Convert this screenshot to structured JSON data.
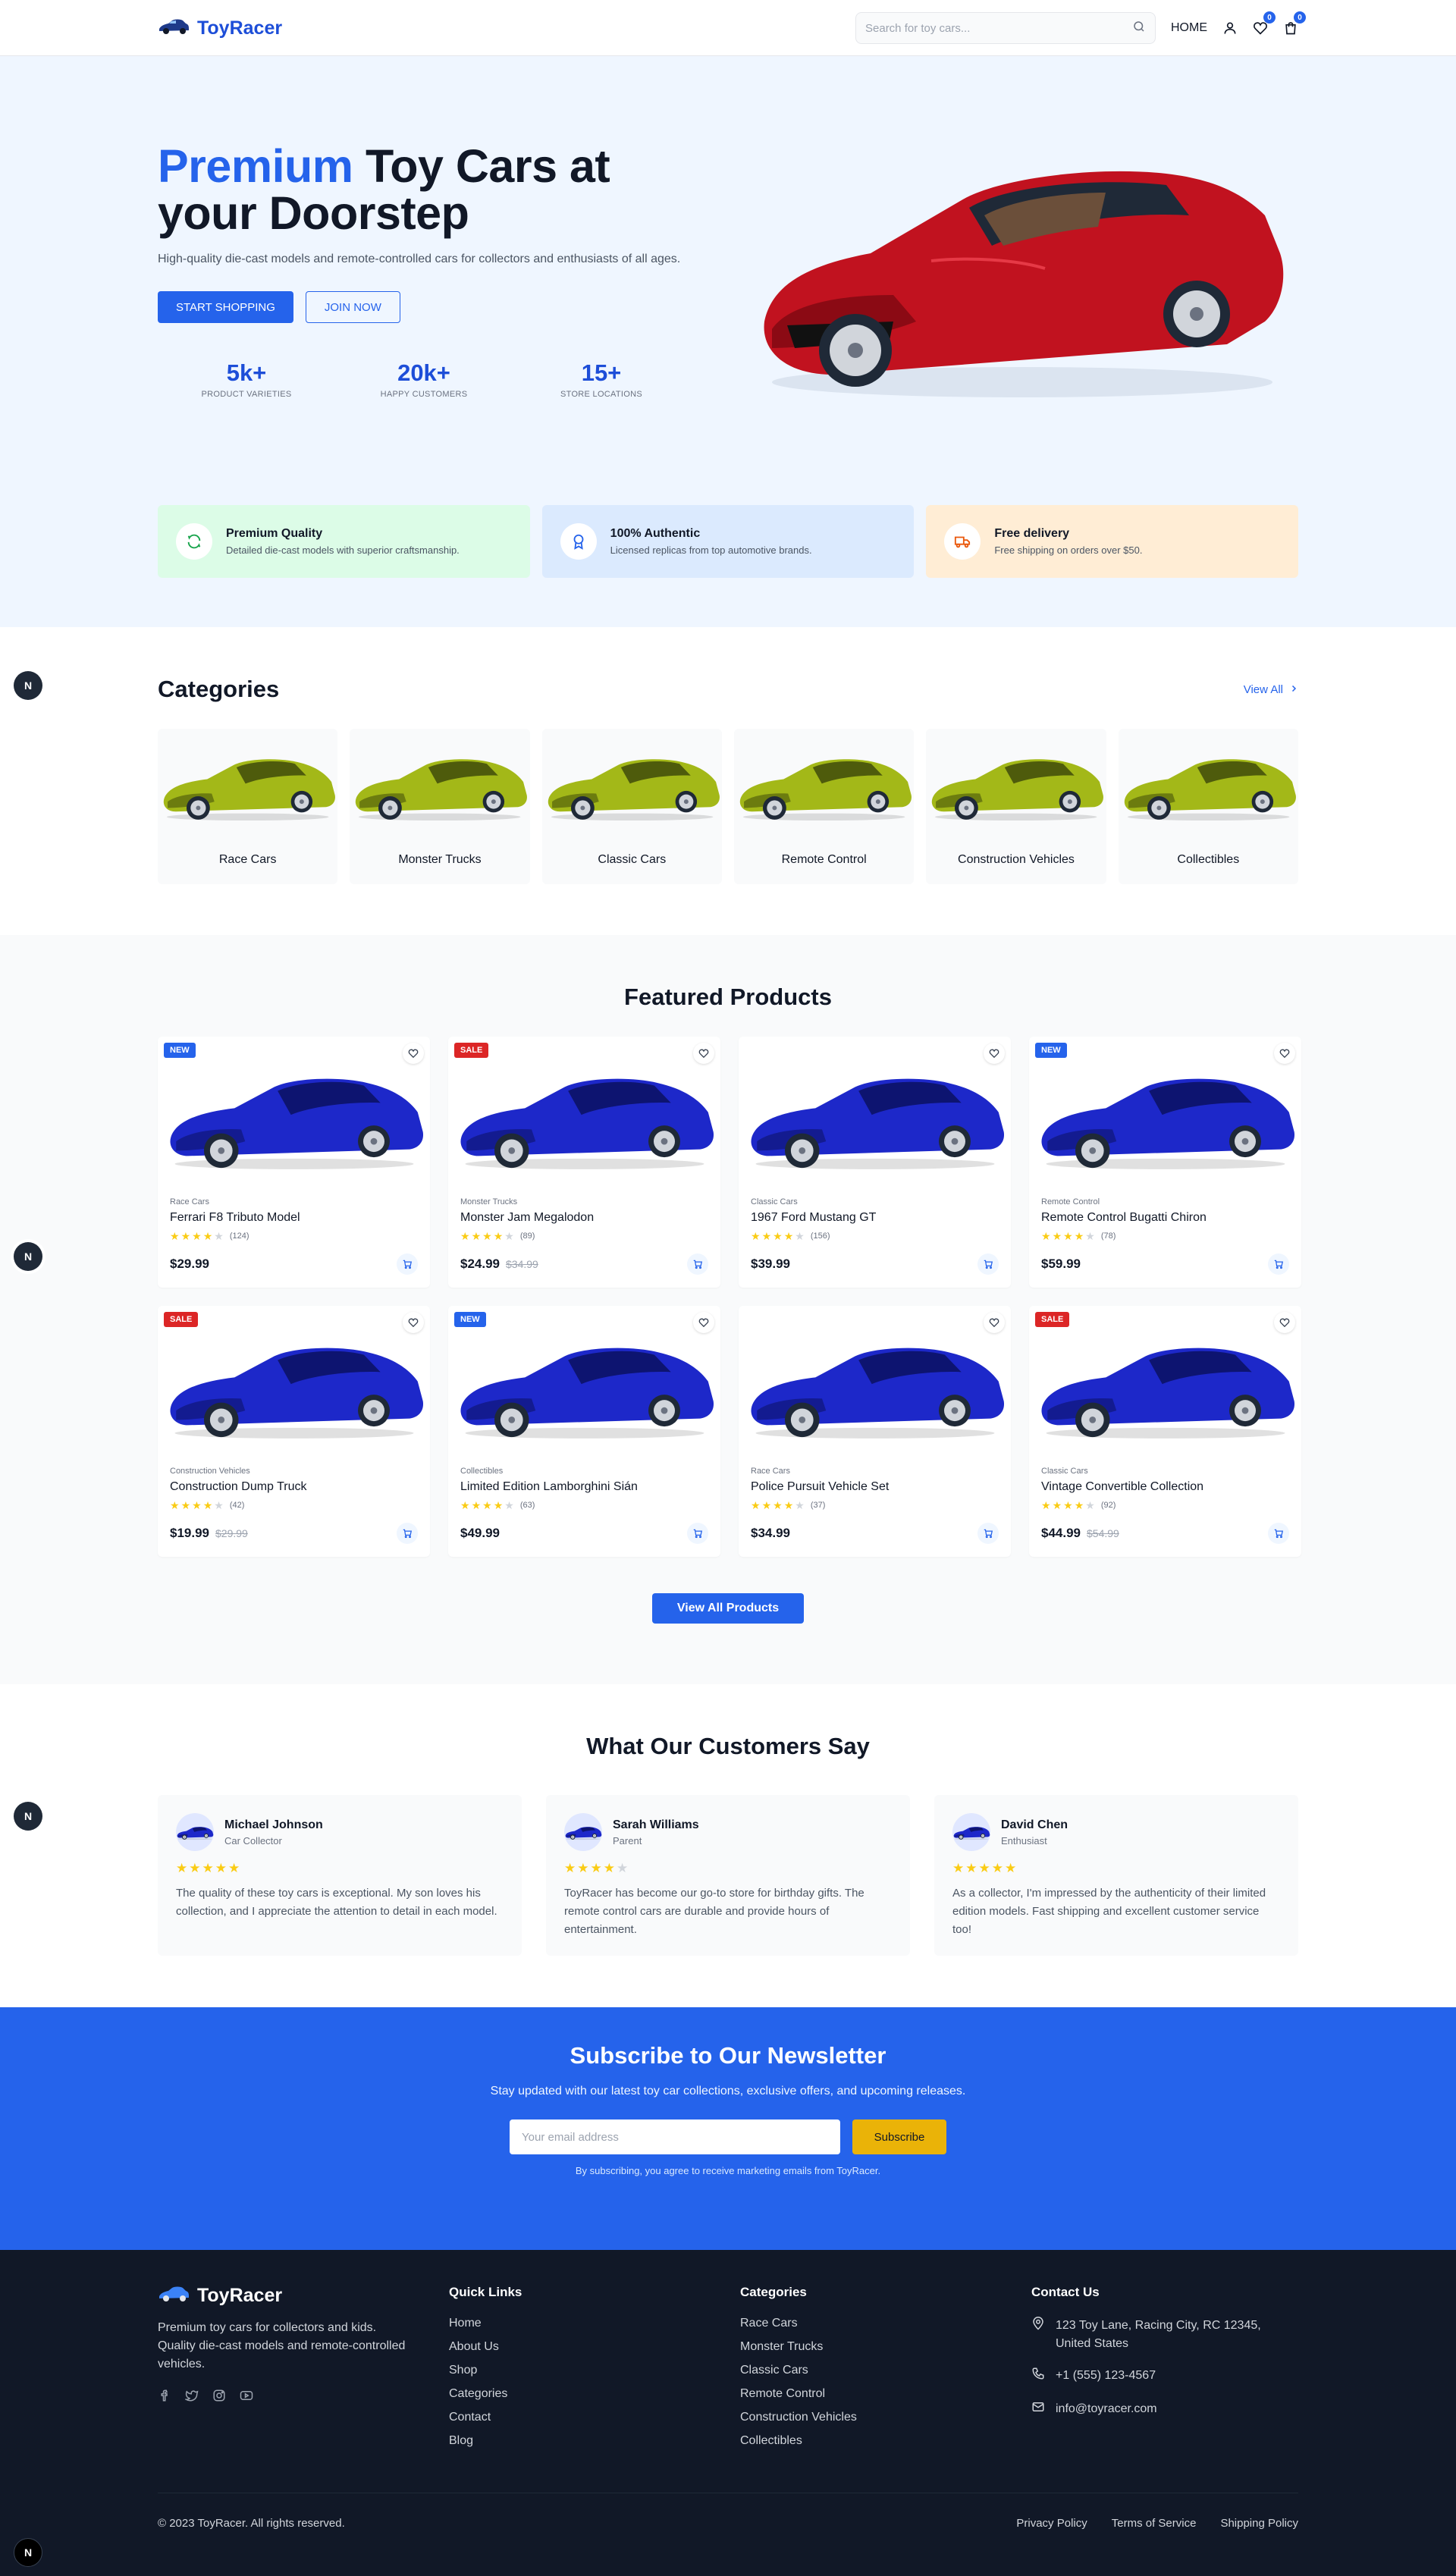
{
  "header": {
    "brand": "ToyRacer",
    "search_placeholder": "Search for toy cars...",
    "nav_home": "HOME",
    "wishlist_count": "0",
    "cart_count": "0"
  },
  "hero": {
    "title_highlight": "Premium",
    "title_rest": " Toy Cars at your Doorstep",
    "subtitle": "High-quality die-cast models and remote-controlled cars for collectors and enthusiasts of all ages.",
    "primary_button": "START SHOPPING",
    "secondary_button": "JOIN NOW",
    "stats": [
      {
        "value": "5k+",
        "label": "PRODUCT VARIETIES"
      },
      {
        "value": "20k+",
        "label": "HAPPY CUSTOMERS"
      },
      {
        "value": "15+",
        "label": "STORE LOCATIONS"
      }
    ]
  },
  "features": [
    {
      "title": "Premium Quality",
      "desc": "Detailed die-cast models with superior craftsmanship.",
      "bg": "#dcfce7",
      "icon": "refresh-icon",
      "color": "#16a34a"
    },
    {
      "title": "100% Authentic",
      "desc": "Licensed replicas from top automotive brands.",
      "bg": "#dbeafe",
      "icon": "award-icon",
      "color": "#2563eb"
    },
    {
      "title": "Free delivery",
      "desc": "Free shipping on orders over $50.",
      "bg": "#ffedd5",
      "icon": "truck-icon",
      "color": "#ea580c"
    }
  ],
  "categories": {
    "title": "Categories",
    "view_all": "View All",
    "items": [
      "Race Cars",
      "Monster Trucks",
      "Classic Cars",
      "Remote Control",
      "Construction Vehicles",
      "Collectibles"
    ]
  },
  "featured": {
    "title": "Featured Products",
    "view_all_button": "View All Products",
    "products": [
      {
        "badge": "NEW",
        "category": "Race Cars",
        "name": "Ferrari F8 Tributo Model",
        "rating": 4,
        "reviews": "(124)",
        "price": "$29.99",
        "old_price": ""
      },
      {
        "badge": "SALE",
        "category": "Monster Trucks",
        "name": "Monster Jam Megalodon",
        "rating": 4,
        "reviews": "(89)",
        "price": "$24.99",
        "old_price": "$34.99"
      },
      {
        "badge": "",
        "category": "Classic Cars",
        "name": "1967 Ford Mustang GT",
        "rating": 4,
        "reviews": "(156)",
        "price": "$39.99",
        "old_price": ""
      },
      {
        "badge": "NEW",
        "category": "Remote Control",
        "name": "Remote Control Bugatti Chiron",
        "rating": 4,
        "reviews": "(78)",
        "price": "$59.99",
        "old_price": ""
      },
      {
        "badge": "SALE",
        "category": "Construction Vehicles",
        "name": "Construction Dump Truck",
        "rating": 4,
        "reviews": "(42)",
        "price": "$19.99",
        "old_price": "$29.99"
      },
      {
        "badge": "NEW",
        "category": "Collectibles",
        "name": "Limited Edition Lamborghini Sián",
        "rating": 4,
        "reviews": "(63)",
        "price": "$49.99",
        "old_price": ""
      },
      {
        "badge": "",
        "category": "Race Cars",
        "name": "Police Pursuit Vehicle Set",
        "rating": 4,
        "reviews": "(37)",
        "price": "$34.99",
        "old_price": ""
      },
      {
        "badge": "SALE",
        "category": "Classic Cars",
        "name": "Vintage Convertible Collection",
        "rating": 4,
        "reviews": "(92)",
        "price": "$44.99",
        "old_price": "$54.99"
      }
    ],
    "badge_colors": {
      "NEW": "#2563eb",
      "SALE": "#dc2626"
    }
  },
  "testimonials": {
    "title": "What Our Customers Say",
    "items": [
      {
        "name": "Michael Johnson",
        "role": "Car Collector",
        "rating": 5,
        "text": "The quality of these toy cars is exceptional. My son loves his collection, and I appreciate the attention to detail in each model."
      },
      {
        "name": "Sarah Williams",
        "role": "Parent",
        "rating": 4,
        "text": "ToyRacer has become our go-to store for birthday gifts. The remote control cars are durable and provide hours of entertainment."
      },
      {
        "name": "David Chen",
        "role": "Enthusiast",
        "rating": 5,
        "text": "As a collector, I'm impressed by the authenticity of their limited edition models. Fast shipping and excellent customer service too!"
      }
    ]
  },
  "newsletter": {
    "title": "Subscribe to Our Newsletter",
    "subtitle": "Stay updated with our latest toy car collections, exclusive offers, and upcoming releases.",
    "placeholder": "Your email address",
    "button": "Subscribe",
    "note": "By subscribing, you agree to receive marketing emails from ToyRacer."
  },
  "footer": {
    "brand": "ToyRacer",
    "description": "Premium toy cars for collectors and kids. Quality die-cast models and remote-controlled vehicles.",
    "quick_links_title": "Quick Links",
    "quick_links": [
      "Home",
      "About Us",
      "Shop",
      "Categories",
      "Contact",
      "Blog"
    ],
    "categories_title": "Categories",
    "categories": [
      "Race Cars",
      "Monster Trucks",
      "Classic Cars",
      "Remote Control",
      "Construction Vehicles",
      "Collectibles"
    ],
    "contact_title": "Contact Us",
    "address": "123 Toy Lane, Racing City, RC 12345, United States",
    "phone": "+1 (555) 123-4567",
    "email": "info@toyracer.com",
    "copyright": "© 2023 ToyRacer. All rights reserved.",
    "legal": [
      "Privacy Policy",
      "Terms of Service",
      "Shipping Policy"
    ]
  },
  "floating_badge": "N",
  "colors": {
    "accent": "#2563eb",
    "star": "#facc15",
    "footer_bg": "#111827",
    "newsletter_bg": "#2563eb"
  }
}
